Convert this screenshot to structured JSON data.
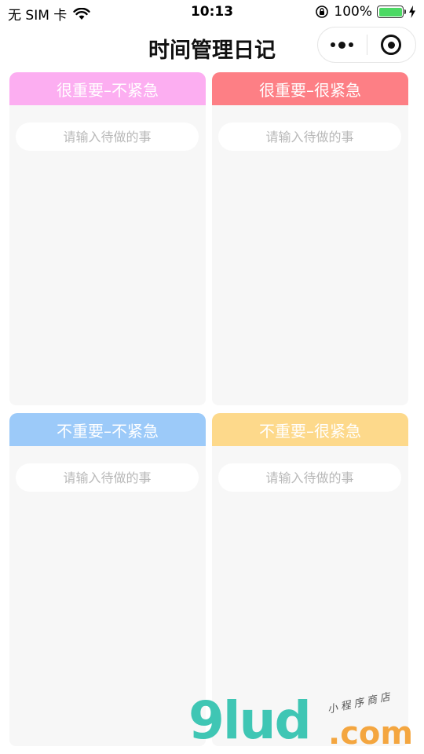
{
  "status_bar": {
    "carrier": "无 SIM 卡",
    "time": "10:13",
    "battery_percent": "100%",
    "battery_level": 1.0
  },
  "nav": {
    "title": "时间管理日记",
    "more_icon": "more-dots-icon",
    "close_icon": "target-circle-icon"
  },
  "quadrants": [
    {
      "title": "很重要–不紧急",
      "color": "#fcaef1",
      "placeholder": "请输入待做的事"
    },
    {
      "title": "很重要–很紧急",
      "color": "#fd7f85",
      "placeholder": "请输入待做的事"
    },
    {
      "title": "不重要–不紧急",
      "color": "#9ccaf9",
      "placeholder": "请输入待做的事"
    },
    {
      "title": "不重要–很紧急",
      "color": "#fdd98b",
      "placeholder": "请输入待做的事"
    }
  ],
  "watermark": {
    "main": "9lud",
    "suffix": ".com",
    "subtitle": "小程序商店"
  }
}
